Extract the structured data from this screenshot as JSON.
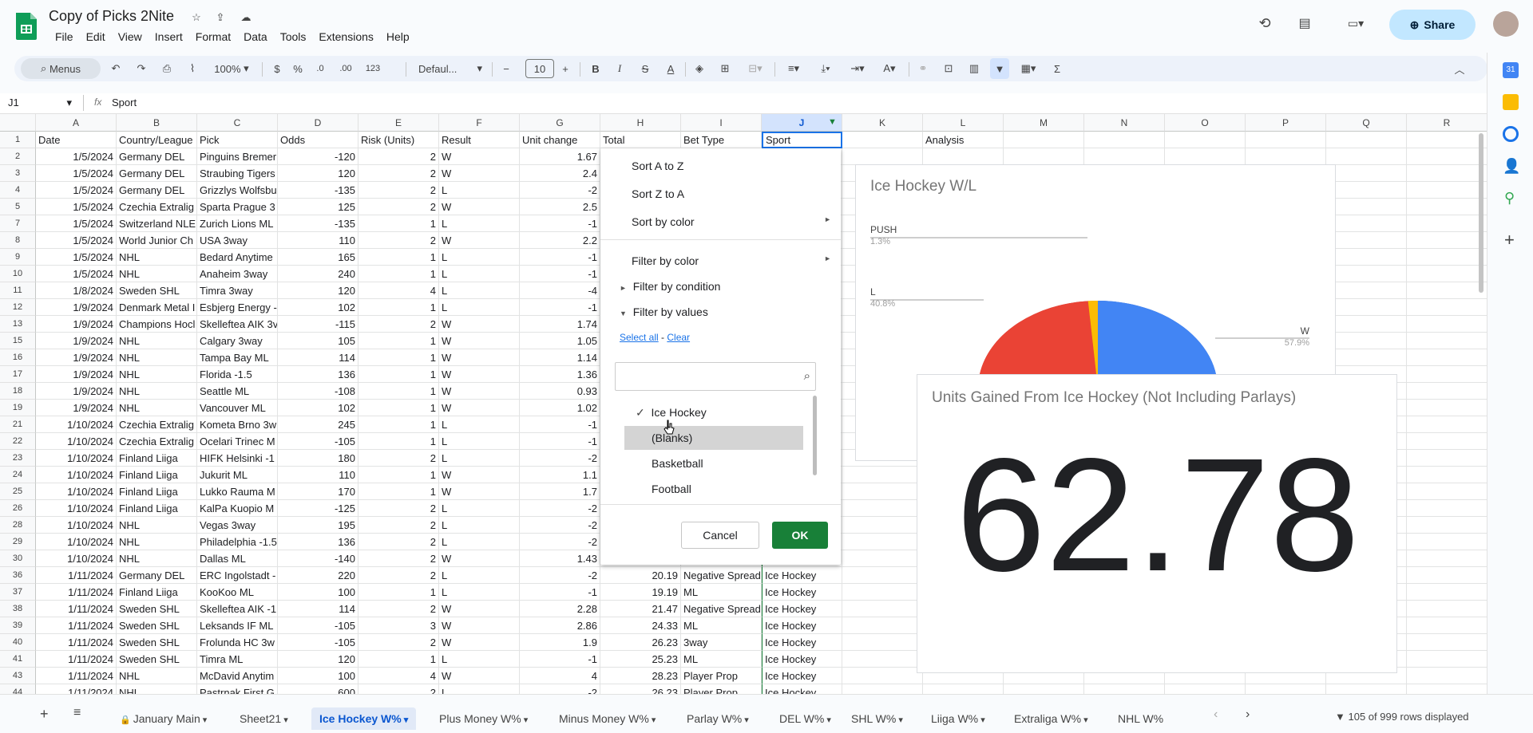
{
  "app": {
    "title": "Copy of Picks 2Nite",
    "menu": [
      "File",
      "Edit",
      "View",
      "Insert",
      "Format",
      "Data",
      "Tools",
      "Extensions",
      "Help"
    ],
    "share_label": "Share"
  },
  "toolbar": {
    "search_label": "Menus",
    "zoom": "100%",
    "currency": "$",
    "percent": "%",
    "dec_less": ".0",
    "dec_more": ".00",
    "number_format": "123",
    "font": "Defaul...",
    "font_size": "10",
    "bold": "B",
    "italic": "I",
    "strike": "S",
    "text_color": "A",
    "sum_icon": "Σ"
  },
  "formula_bar": {
    "cell_ref": "J1",
    "fx": "fx",
    "value": "Sport"
  },
  "columns": [
    "A",
    "B",
    "C",
    "D",
    "E",
    "F",
    "G",
    "H",
    "I",
    "J",
    "K",
    "L",
    "M",
    "N",
    "O",
    "P",
    "Q",
    "R"
  ],
  "rows": [
    {
      "n": "1",
      "A": "Date",
      "B": "Country/League",
      "C": "Pick",
      "D": "Odds",
      "E": "Risk (Units)",
      "F": "Result",
      "G": "Unit change",
      "H": "Total",
      "I": "Bet Type",
      "J": "Sport",
      "L": "Analysis"
    },
    {
      "n": "2",
      "A": "1/5/2024",
      "B": "Germany DEL",
      "C": "Pinguins Bremer",
      "D": "-120",
      "E": "2",
      "F": "W",
      "G": "1.67"
    },
    {
      "n": "3",
      "A": "1/5/2024",
      "B": "Germany DEL",
      "C": "Straubing Tigers",
      "D": "120",
      "E": "2",
      "F": "W",
      "G": "2.4"
    },
    {
      "n": "4",
      "A": "1/5/2024",
      "B": "Germany DEL",
      "C": "Grizzlys Wolfsbu",
      "D": "-135",
      "E": "2",
      "F": "L",
      "G": "-2"
    },
    {
      "n": "5",
      "A": "1/5/2024",
      "B": "Czechia Extralig",
      "C": "Sparta Prague 3",
      "D": "125",
      "E": "2",
      "F": "W",
      "G": "2.5"
    },
    {
      "n": "7",
      "A": "1/5/2024",
      "B": "Switzerland NLE",
      "C": "Zurich Lions ML",
      "D": "-135",
      "E": "1",
      "F": "L",
      "G": "-1"
    },
    {
      "n": "8",
      "A": "1/5/2024",
      "B": "World Junior Ch",
      "C": "USA 3way",
      "D": "110",
      "E": "2",
      "F": "W",
      "G": "2.2"
    },
    {
      "n": "9",
      "A": "1/5/2024",
      "B": "NHL",
      "C": "Bedard Anytime",
      "D": "165",
      "E": "1",
      "F": "L",
      "G": "-1"
    },
    {
      "n": "10",
      "A": "1/5/2024",
      "B": "NHL",
      "C": "Anaheim 3way",
      "D": "240",
      "E": "1",
      "F": "L",
      "G": "-1"
    },
    {
      "n": "11",
      "A": "1/8/2024",
      "B": "Sweden SHL",
      "C": "Timra 3way",
      "D": "120",
      "E": "4",
      "F": "L",
      "G": "-4"
    },
    {
      "n": "12",
      "A": "1/9/2024",
      "B": "Denmark Metal I",
      "C": "Esbjerg Energy -",
      "D": "102",
      "E": "1",
      "F": "L",
      "G": "-1"
    },
    {
      "n": "13",
      "A": "1/9/2024",
      "B": "Champions Hocl",
      "C": "Skelleftea AIK 3v",
      "D": "-115",
      "E": "2",
      "F": "W",
      "G": "1.74"
    },
    {
      "n": "15",
      "A": "1/9/2024",
      "B": "NHL",
      "C": "Calgary 3way",
      "D": "105",
      "E": "1",
      "F": "W",
      "G": "1.05"
    },
    {
      "n": "16",
      "A": "1/9/2024",
      "B": "NHL",
      "C": "Tampa Bay ML",
      "D": "114",
      "E": "1",
      "F": "W",
      "G": "1.14"
    },
    {
      "n": "17",
      "A": "1/9/2024",
      "B": "NHL",
      "C": "Florida -1.5",
      "D": "136",
      "E": "1",
      "F": "W",
      "G": "1.36"
    },
    {
      "n": "18",
      "A": "1/9/2024",
      "B": "NHL",
      "C": "Seattle ML",
      "D": "-108",
      "E": "1",
      "F": "W",
      "G": "0.93"
    },
    {
      "n": "19",
      "A": "1/9/2024",
      "B": "NHL",
      "C": "Vancouver ML",
      "D": "102",
      "E": "1",
      "F": "W",
      "G": "1.02"
    },
    {
      "n": "21",
      "A": "1/10/2024",
      "B": "Czechia Extralig",
      "C": "Kometa Brno 3w",
      "D": "245",
      "E": "1",
      "F": "L",
      "G": "-1"
    },
    {
      "n": "22",
      "A": "1/10/2024",
      "B": "Czechia Extralig",
      "C": "Ocelari Trinec M",
      "D": "-105",
      "E": "1",
      "F": "L",
      "G": "-1"
    },
    {
      "n": "23",
      "A": "1/10/2024",
      "B": "Finland Liiga",
      "C": "HIFK Helsinki -1",
      "D": "180",
      "E": "2",
      "F": "L",
      "G": "-2"
    },
    {
      "n": "24",
      "A": "1/10/2024",
      "B": "Finland Liiga",
      "C": "Jukurit ML",
      "D": "110",
      "E": "1",
      "F": "W",
      "G": "1.1"
    },
    {
      "n": "25",
      "A": "1/10/2024",
      "B": "Finland Liiga",
      "C": "Lukko Rauma M",
      "D": "170",
      "E": "1",
      "F": "W",
      "G": "1.7"
    },
    {
      "n": "26",
      "A": "1/10/2024",
      "B": "Finland Liiga",
      "C": "KalPa Kuopio M",
      "D": "-125",
      "E": "2",
      "F": "L",
      "G": "-2"
    },
    {
      "n": "28",
      "A": "1/10/2024",
      "B": "NHL",
      "C": "Vegas 3way",
      "D": "195",
      "E": "2",
      "F": "L",
      "G": "-2"
    },
    {
      "n": "29",
      "A": "1/10/2024",
      "B": "NHL",
      "C": "Philadelphia -1.5",
      "D": "136",
      "E": "2",
      "F": "L",
      "G": "-2"
    },
    {
      "n": "30",
      "A": "1/10/2024",
      "B": "NHL",
      "C": "Dallas ML",
      "D": "-140",
      "E": "2",
      "F": "W",
      "G": "1.43"
    },
    {
      "n": "36",
      "A": "1/11/2024",
      "B": "Germany DEL",
      "C": "ERC Ingolstadt -",
      "D": "220",
      "E": "2",
      "F": "L",
      "G": "-2",
      "H": "20.19",
      "I": "Negative Spread",
      "J": "Ice Hockey"
    },
    {
      "n": "37",
      "A": "1/11/2024",
      "B": "Finland Liiga",
      "C": "KooKoo ML",
      "D": "100",
      "E": "1",
      "F": "L",
      "G": "-1",
      "H": "19.19",
      "I": "ML",
      "J": "Ice Hockey"
    },
    {
      "n": "38",
      "A": "1/11/2024",
      "B": "Sweden SHL",
      "C": "Skelleftea AIK -1",
      "D": "114",
      "E": "2",
      "F": "W",
      "G": "2.28",
      "H": "21.47",
      "I": "Negative Spread",
      "J": "Ice Hockey"
    },
    {
      "n": "39",
      "A": "1/11/2024",
      "B": "Sweden SHL",
      "C": "Leksands IF ML",
      "D": "-105",
      "E": "3",
      "F": "W",
      "G": "2.86",
      "H": "24.33",
      "I": "ML",
      "J": "Ice Hockey"
    },
    {
      "n": "40",
      "A": "1/11/2024",
      "B": "Sweden SHL",
      "C": "Frolunda HC 3w",
      "D": "-105",
      "E": "2",
      "F": "W",
      "G": "1.9",
      "H": "26.23",
      "I": "3way",
      "J": "Ice Hockey"
    },
    {
      "n": "41",
      "A": "1/11/2024",
      "B": "Sweden SHL",
      "C": "Timra ML",
      "D": "120",
      "E": "1",
      "F": "L",
      "G": "-1",
      "H": "25.23",
      "I": "ML",
      "J": "Ice Hockey"
    },
    {
      "n": "43",
      "A": "1/11/2024",
      "B": "NHL",
      "C": "McDavid Anytim",
      "D": "100",
      "E": "4",
      "F": "W",
      "G": "4",
      "H": "28.23",
      "I": "Player Prop",
      "J": "Ice Hockey"
    },
    {
      "n": "44",
      "A": "1/11/2024",
      "B": "NHL",
      "C": "Pastrnak First G",
      "D": "600",
      "E": "2",
      "F": "L",
      "G": "-2",
      "H": "26.23",
      "I": "Player Prop",
      "J": "Ice Hockey"
    }
  ],
  "filter_menu": {
    "sort_az": "Sort A to Z",
    "sort_za": "Sort Z to A",
    "sort_color": "Sort by color",
    "filter_color": "Filter by color",
    "filter_condition": "Filter by condition",
    "filter_values": "Filter by values",
    "select_all": "Select all",
    "dash": " - ",
    "clear": "Clear",
    "values": [
      {
        "label": "Ice Hockey",
        "checked": true
      },
      {
        "label": "(Blanks)",
        "checked": false
      },
      {
        "label": "Basketball",
        "checked": false
      },
      {
        "label": "Football",
        "checked": false
      }
    ],
    "cancel": "Cancel",
    "ok": "OK"
  },
  "chart_data": {
    "type": "pie",
    "title": "Ice Hockey W/L",
    "slices": [
      {
        "label": "W",
        "value": 57.9,
        "pct_label": "57.9%",
        "color": "#4285f4"
      },
      {
        "label": "L",
        "value": 40.8,
        "pct_label": "40.8%",
        "color": "#ea4335"
      },
      {
        "label": "PUSH",
        "value": 1.3,
        "pct_label": "1.3%",
        "color": "#fbbc04"
      }
    ]
  },
  "scorecard": {
    "title": "Units Gained From Ice Hockey (Not Including Parlays)",
    "value": "62.78"
  },
  "sheet_tabs": [
    "January Main",
    "Sheet21",
    "Ice Hockey W%",
    "Plus Money W%",
    "Minus Money W%",
    "Parlay W%",
    "DEL W%",
    "SHL W%",
    "Liiga W%",
    "Extraliga W%",
    "NHL W%"
  ],
  "active_tab": "Ice Hockey W%",
  "status": "105 of 999 rows displayed"
}
